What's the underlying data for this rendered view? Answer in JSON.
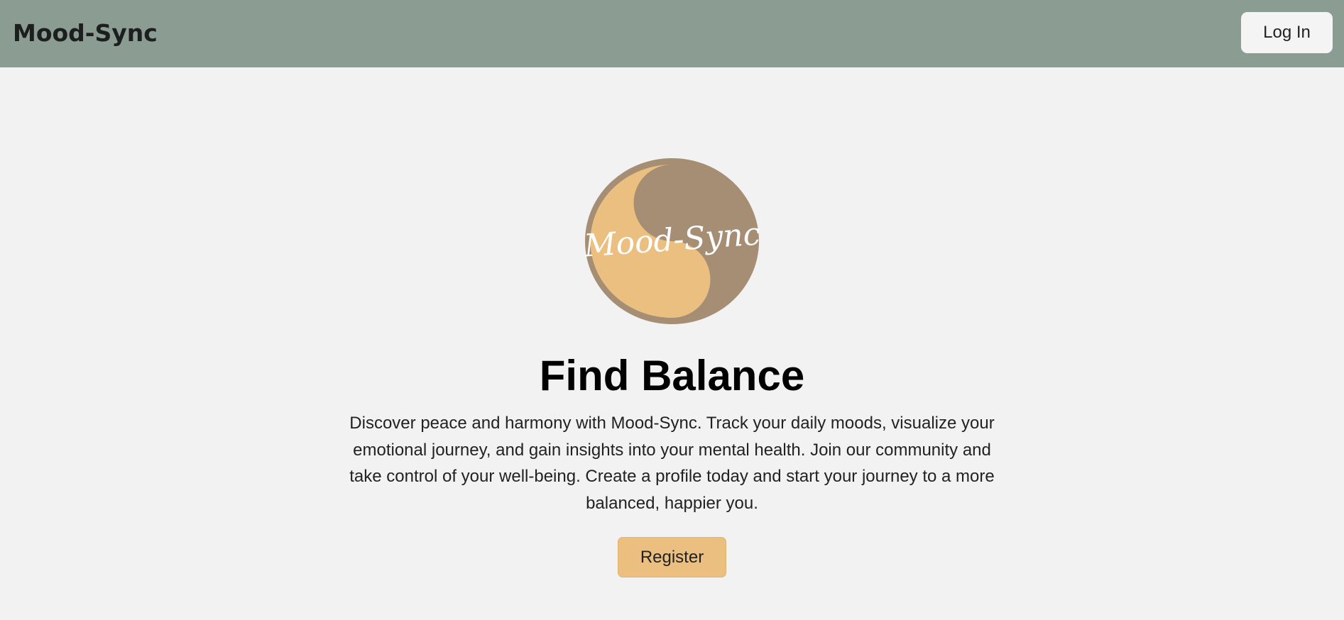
{
  "navbar": {
    "brand": "Mood-Sync",
    "login_label": "Log In"
  },
  "hero": {
    "logo_text": "Mood-Sync",
    "title": "Find Balance",
    "description": "Discover peace and harmony with Mood-Sync. Track your daily moods, visualize your emotional journey, and gain insights into your mental health. Join our community and take control of your well-being. Create a profile today and start your journey to a more balanced, happier you.",
    "register_label": "Register"
  },
  "colors": {
    "navbar_bg": "#8b9d92",
    "page_bg": "#f2f2f2",
    "logo_brown": "#a68e75",
    "logo_tan": "#ebbf7f",
    "register_bg": "#ebbf7f"
  },
  "icons": {
    "logo": "yin-yang-logo"
  }
}
